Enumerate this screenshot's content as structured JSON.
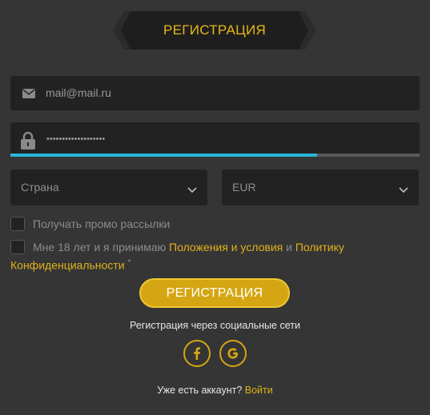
{
  "header": {
    "title": "РЕГИСТРАЦИЯ"
  },
  "form": {
    "email": {
      "value": "mail@mail.ru",
      "icon": "envelope-icon"
    },
    "password": {
      "masked_value": "•••••••••••••••••••",
      "icon": "lock-icon",
      "strength": 0.75
    },
    "country": {
      "value": "Страна",
      "icon": "chevron-down-icon"
    },
    "currency": {
      "value": "EUR",
      "icon": "chevron-down-icon"
    },
    "promo_checkbox": {
      "label": "Получать промо рассылки",
      "checked": false
    },
    "terms_checkbox": {
      "checked": false,
      "prefix": "Мне 18 лет и я принимаю ",
      "terms_link": "Положения и условия",
      "and": " и ",
      "privacy_link": "Политику Конфиденциальности",
      "required_mark": "*"
    },
    "submit_label": "РЕГИСТРАЦИЯ"
  },
  "social": {
    "caption": "Регистрация через социальные сети",
    "buttons": [
      {
        "name": "facebook",
        "icon": "facebook-icon"
      },
      {
        "name": "google",
        "icon": "google-icon"
      }
    ]
  },
  "login": {
    "prompt": "Уже есть аккаунт? ",
    "link": "Войти"
  },
  "colors": {
    "accent": "#d5a613",
    "link": "#e0b21a",
    "strength_bar": "#29b6dc",
    "background": "#353535",
    "field": "#222222"
  }
}
